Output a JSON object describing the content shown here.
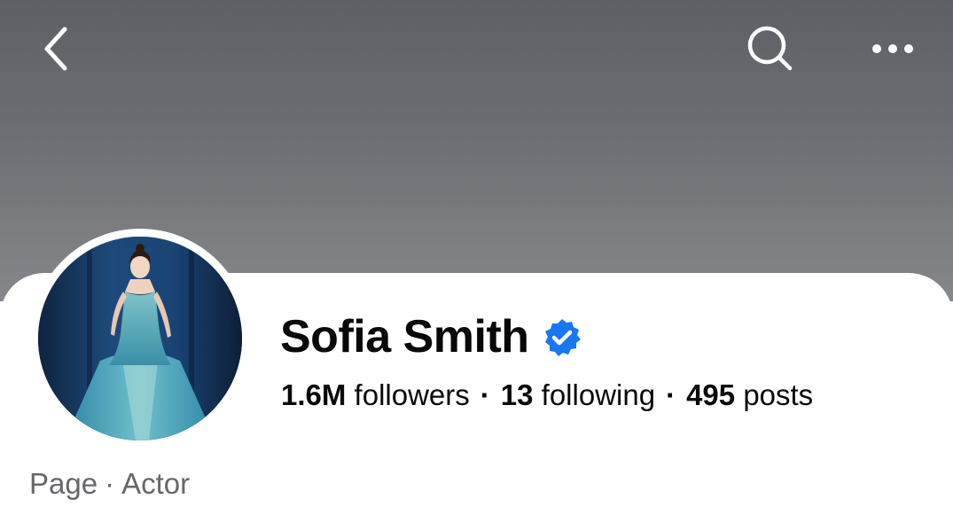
{
  "header": {
    "back_icon": "chevron-left-icon",
    "search_icon": "search-icon",
    "more_icon": "more-horizontal-icon"
  },
  "profile": {
    "name": "Sofia Smith",
    "verified": true,
    "verified_color": "#1877f2",
    "avatar_description_icon": "profile-photo",
    "stats": {
      "followers_count": "1.6M",
      "followers_label": "followers",
      "following_count": "13",
      "following_label": "following",
      "posts_count": "495",
      "posts_label": "posts",
      "separator": "·"
    },
    "category": {
      "type": "Page",
      "separator": "·",
      "label": "Actor"
    }
  },
  "colors": {
    "cover_top": "#5e6065",
    "cover_bottom": "#85878b",
    "text_primary": "#080809",
    "text_secondary": "#65676b"
  }
}
